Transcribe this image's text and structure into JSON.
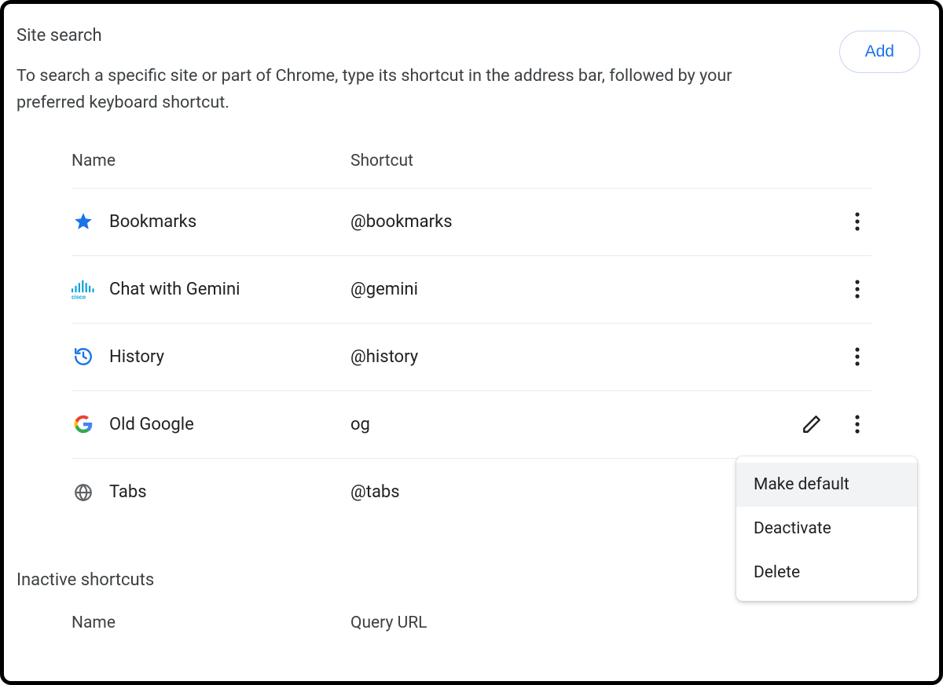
{
  "section": {
    "title": "Site search",
    "description": "To search a specific site or part of Chrome, type its shortcut in the address bar, followed by your preferred keyboard shortcut.",
    "addLabel": "Add"
  },
  "columns": {
    "name": "Name",
    "shortcut": "Shortcut"
  },
  "rows": [
    {
      "icon": "star",
      "name": "Bookmarks",
      "shortcut": "@bookmarks",
      "edit": false
    },
    {
      "icon": "cisco",
      "name": "Chat with Gemini",
      "shortcut": "@gemini",
      "edit": false
    },
    {
      "icon": "history",
      "name": "History",
      "shortcut": "@history",
      "edit": false
    },
    {
      "icon": "google-g",
      "name": "Old Google",
      "shortcut": "og",
      "edit": true
    },
    {
      "icon": "globe",
      "name": "Tabs",
      "shortcut": "@tabs",
      "edit": false
    }
  ],
  "inactive": {
    "title": "Inactive shortcuts",
    "columns": {
      "name": "Name",
      "queryUrl": "Query URL"
    }
  },
  "menu": {
    "items": [
      "Make default",
      "Deactivate",
      "Delete"
    ],
    "hoveredIndex": 0
  }
}
